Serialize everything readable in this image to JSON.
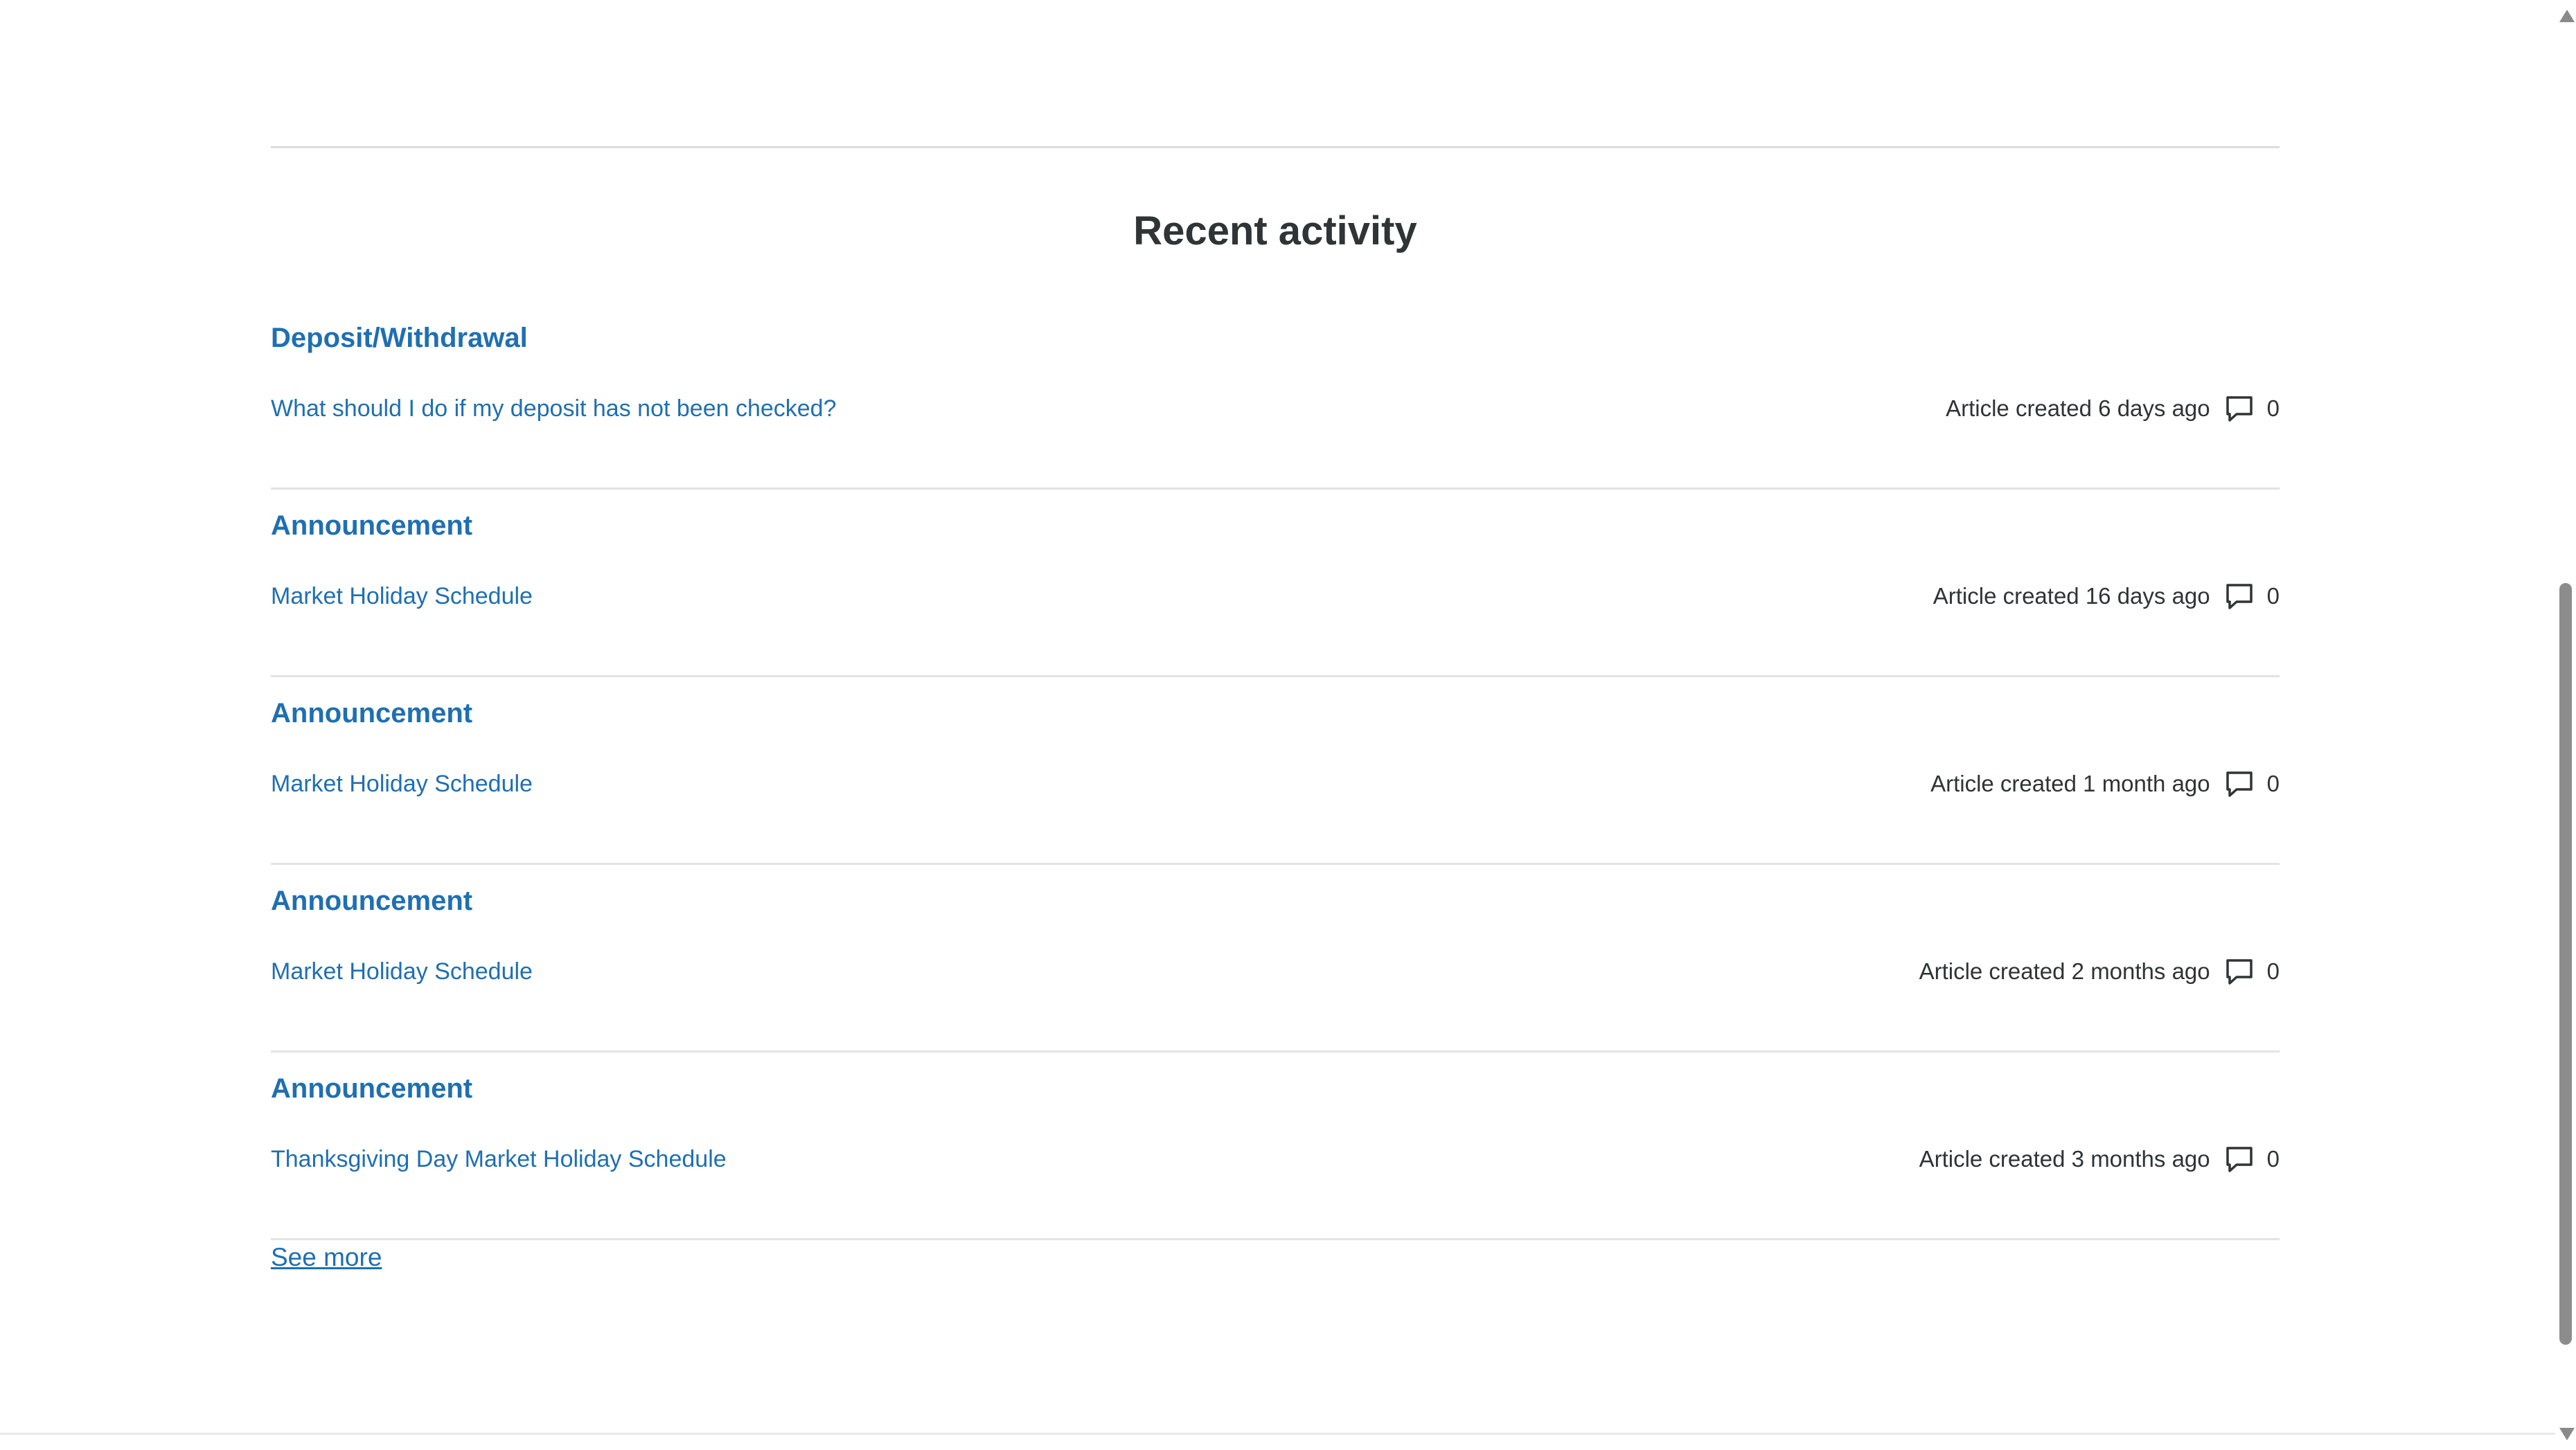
{
  "section": {
    "title": "Recent activity"
  },
  "activities": [
    {
      "category": "Deposit/Withdrawal",
      "article": "What should I do if my deposit has not been checked?",
      "meta": "Article created 6 days ago",
      "comments": "0"
    },
    {
      "category": "Announcement",
      "article": "Market Holiday Schedule",
      "meta": "Article created 16 days ago",
      "comments": "0"
    },
    {
      "category": "Announcement",
      "article": "Market Holiday Schedule",
      "meta": "Article created 1 month ago",
      "comments": "0"
    },
    {
      "category": "Announcement",
      "article": "Market Holiday Schedule",
      "meta": "Article created 2 months ago",
      "comments": "0"
    },
    {
      "category": "Announcement",
      "article": "Thanksgiving Day Market Holiday Schedule",
      "meta": "Article created 3 months ago",
      "comments": "0"
    }
  ],
  "see_more": {
    "label": "See more"
  },
  "icons": {
    "comment": "comment-icon"
  },
  "colors": {
    "link": "#1f6fb2",
    "text": "#2f3437",
    "divider": "#e3e3e3"
  }
}
